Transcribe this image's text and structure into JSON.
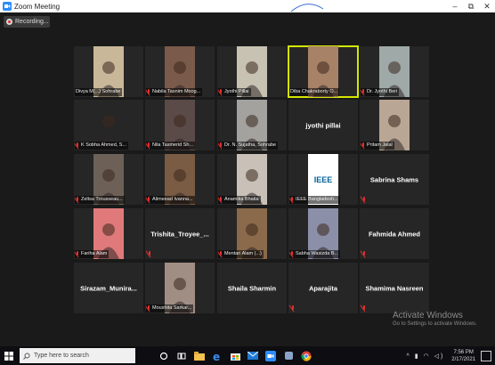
{
  "window": {
    "title": "Zoom Meeting",
    "controls": [
      "–",
      "⧉",
      "✕"
    ]
  },
  "recording": {
    "label": "Recording..."
  },
  "tiles": [
    {
      "name": "Divya M(...) Sohrabe",
      "type": "video",
      "video_color": "#c9b79a",
      "muted": false
    },
    {
      "name": "Nabila Tasnim Moog...",
      "type": "video",
      "video_color": "#7a5a4a",
      "muted": true
    },
    {
      "name": "Jyothi Pillai",
      "type": "video",
      "video_color": "#c7c2b2",
      "muted": true
    },
    {
      "name": "Diba Chakraborty O...",
      "type": "video",
      "video_color": "#a88266",
      "muted": false,
      "active": true
    },
    {
      "name": "Dr. Jyothi Beri",
      "type": "video",
      "video_color": "#9ea9a8",
      "muted": true
    },
    {
      "name": "K Sobha Ahmed, S...",
      "type": "video",
      "video_color": "#262626",
      "muted": true
    },
    {
      "name": "Nila Tasmerid Sh...",
      "type": "video",
      "video_color": "#5a4a48",
      "muted": true
    },
    {
      "name": "Dr. N. Sujatha, Sohrabe",
      "type": "video",
      "video_color": "#a3a29f",
      "muted": true
    },
    {
      "name": "jyothi pillai",
      "type": "name",
      "muted": false
    },
    {
      "name": "Pritam Jalal",
      "type": "video",
      "video_color": "#b9a694",
      "muted": true
    },
    {
      "name": "Zeltsa Trousseau...",
      "type": "video",
      "video_color": "#6d6157",
      "muted": true
    },
    {
      "name": "Alimeead Ivanna...",
      "type": "video",
      "video_color": "#7a5b43",
      "muted": true
    },
    {
      "name": "Anamika Bhatia",
      "type": "video",
      "video_color": "#c9c1b8",
      "muted": true
    },
    {
      "name": "IEEE Bangladesh...",
      "type": "logo",
      "logo_text": "IEEE",
      "muted": true
    },
    {
      "name": "Sabrina Shams",
      "type": "name",
      "muted": true
    },
    {
      "name": "Fariha Alam",
      "type": "video",
      "video_color": "#e07a7a",
      "muted": true
    },
    {
      "name": "Trishita_Troyee_...",
      "type": "name",
      "muted": true
    },
    {
      "name": "Mentari Alam (...)",
      "type": "video",
      "video_color": "#8a6a4a",
      "muted": true
    },
    {
      "name": "Sabha Wasizda B...",
      "type": "video",
      "video_color": "#8b8fa8",
      "muted": true
    },
    {
      "name": "Fahmida Ahmed",
      "type": "name",
      "muted": true
    },
    {
      "name": "Sirazam_Munira...",
      "type": "name",
      "muted": false
    },
    {
      "name": "Moushita Sarkar...",
      "type": "video",
      "video_color": "#a08e84",
      "muted": true
    },
    {
      "name": "Shaila Sharmin",
      "type": "name",
      "muted": false
    },
    {
      "name": "Aparajita",
      "type": "name",
      "muted": true
    },
    {
      "name": "Shamima Nasreen",
      "type": "name",
      "muted": true
    }
  ],
  "watermark": {
    "title": "Activate Windows",
    "subtitle": "Go to Settings to activate Windows."
  },
  "taskbar": {
    "search_placeholder": "Type here to search",
    "icons": [
      "cortana-icon",
      "task-view-icon",
      "file-explorer-icon",
      "edge-icon",
      "store-icon",
      "mail-icon",
      "zoom-icon",
      "app-icon",
      "chrome-icon"
    ],
    "time": "7:56 PM",
    "date": "2/17/2021"
  }
}
